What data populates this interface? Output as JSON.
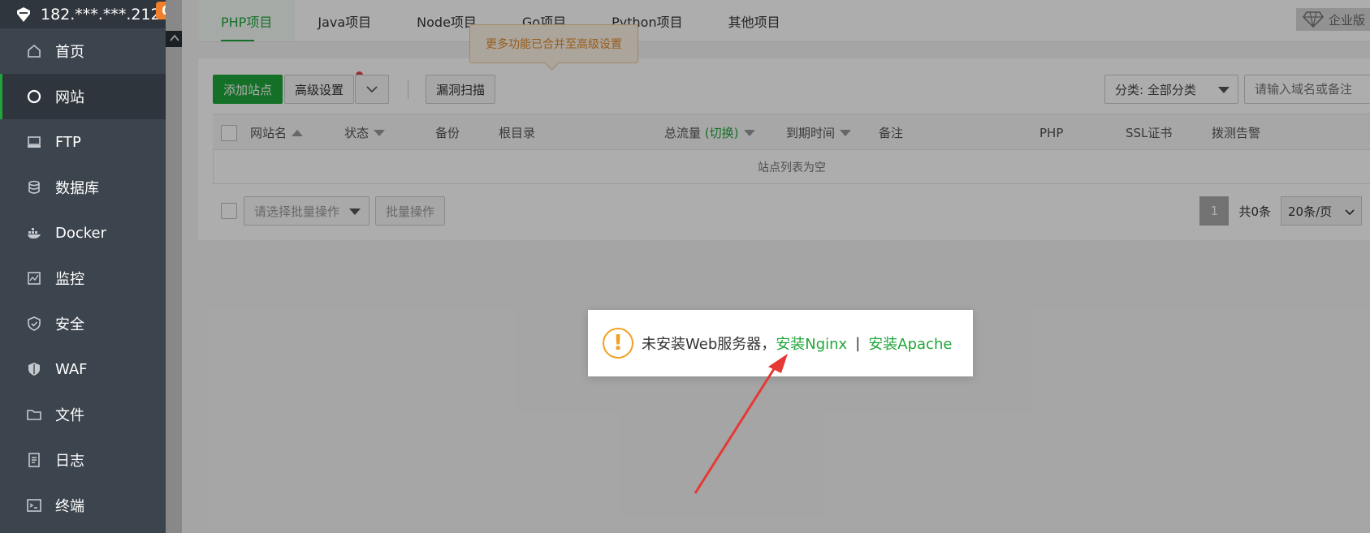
{
  "sidebar": {
    "server_ip": "182.***.***.212",
    "badge_count": "0",
    "items": [
      {
        "label": "首页",
        "icon": "home-icon"
      },
      {
        "label": "网站",
        "icon": "globe-icon"
      },
      {
        "label": "FTP",
        "icon": "ftp-icon"
      },
      {
        "label": "数据库",
        "icon": "database-icon"
      },
      {
        "label": "Docker",
        "icon": "docker-icon"
      },
      {
        "label": "监控",
        "icon": "monitor-icon"
      },
      {
        "label": "安全",
        "icon": "shield-icon"
      },
      {
        "label": "WAF",
        "icon": "waf-icon"
      },
      {
        "label": "文件",
        "icon": "folder-icon"
      },
      {
        "label": "日志",
        "icon": "log-icon"
      },
      {
        "label": "终端",
        "icon": "terminal-icon"
      }
    ],
    "active_index": 1
  },
  "tabs": [
    "PHP项目",
    "Java项目",
    "Node项目",
    "Go项目",
    "Python项目",
    "其他项目"
  ],
  "active_tab": 0,
  "enterprise_label": "企业版",
  "tooltip": "更多功能已合并至高级设置",
  "toolbar": {
    "add_site": "添加站点",
    "advanced": "高级设置",
    "scan": "漏洞扫描",
    "category": "分类: 全部分类",
    "search_placeholder": "请输入域名或备注"
  },
  "table": {
    "headers": [
      "网站名",
      "状态",
      "备份",
      "根目录",
      "总流量",
      "(切换)",
      "到期时间",
      "备注",
      "PHP",
      "SSL证书",
      "拨测告警"
    ],
    "empty_text": "站点列表为空"
  },
  "footer": {
    "batch_placeholder": "请选择批量操作",
    "batch_button": "批量操作",
    "page": "1",
    "total": "共0条",
    "per_page": "20条/页"
  },
  "dialog": {
    "message": "未安装Web服务器，",
    "install_nginx": "安装Nginx",
    "separator": "|",
    "install_apache": "安装Apache"
  },
  "colors": {
    "accent": "#20a53a",
    "sidebar_bg": "#3c444d",
    "warning": "#f0a020",
    "arrow": "#e53935"
  }
}
